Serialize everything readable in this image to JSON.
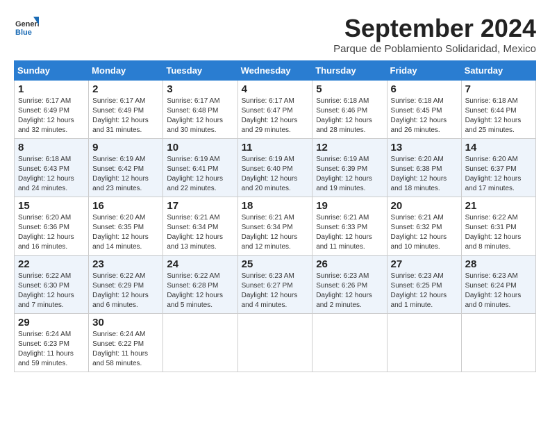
{
  "logo": {
    "general": "General",
    "blue": "Blue"
  },
  "title": "September 2024",
  "subtitle": "Parque de Poblamiento Solidaridad, Mexico",
  "days_of_week": [
    "Sunday",
    "Monday",
    "Tuesday",
    "Wednesday",
    "Thursday",
    "Friday",
    "Saturday"
  ],
  "weeks": [
    [
      {
        "day": "1",
        "sunrise": "6:17 AM",
        "sunset": "6:49 PM",
        "daylight": "12 hours and 32 minutes."
      },
      {
        "day": "2",
        "sunrise": "6:17 AM",
        "sunset": "6:49 PM",
        "daylight": "12 hours and 31 minutes."
      },
      {
        "day": "3",
        "sunrise": "6:17 AM",
        "sunset": "6:48 PM",
        "daylight": "12 hours and 30 minutes."
      },
      {
        "day": "4",
        "sunrise": "6:17 AM",
        "sunset": "6:47 PM",
        "daylight": "12 hours and 29 minutes."
      },
      {
        "day": "5",
        "sunrise": "6:18 AM",
        "sunset": "6:46 PM",
        "daylight": "12 hours and 28 minutes."
      },
      {
        "day": "6",
        "sunrise": "6:18 AM",
        "sunset": "6:45 PM",
        "daylight": "12 hours and 26 minutes."
      },
      {
        "day": "7",
        "sunrise": "6:18 AM",
        "sunset": "6:44 PM",
        "daylight": "12 hours and 25 minutes."
      }
    ],
    [
      {
        "day": "8",
        "sunrise": "6:18 AM",
        "sunset": "6:43 PM",
        "daylight": "12 hours and 24 minutes."
      },
      {
        "day": "9",
        "sunrise": "6:19 AM",
        "sunset": "6:42 PM",
        "daylight": "12 hours and 23 minutes."
      },
      {
        "day": "10",
        "sunrise": "6:19 AM",
        "sunset": "6:41 PM",
        "daylight": "12 hours and 22 minutes."
      },
      {
        "day": "11",
        "sunrise": "6:19 AM",
        "sunset": "6:40 PM",
        "daylight": "12 hours and 20 minutes."
      },
      {
        "day": "12",
        "sunrise": "6:19 AM",
        "sunset": "6:39 PM",
        "daylight": "12 hours and 19 minutes."
      },
      {
        "day": "13",
        "sunrise": "6:20 AM",
        "sunset": "6:38 PM",
        "daylight": "12 hours and 18 minutes."
      },
      {
        "day": "14",
        "sunrise": "6:20 AM",
        "sunset": "6:37 PM",
        "daylight": "12 hours and 17 minutes."
      }
    ],
    [
      {
        "day": "15",
        "sunrise": "6:20 AM",
        "sunset": "6:36 PM",
        "daylight": "12 hours and 16 minutes."
      },
      {
        "day": "16",
        "sunrise": "6:20 AM",
        "sunset": "6:35 PM",
        "daylight": "12 hours and 14 minutes."
      },
      {
        "day": "17",
        "sunrise": "6:21 AM",
        "sunset": "6:34 PM",
        "daylight": "12 hours and 13 minutes."
      },
      {
        "day": "18",
        "sunrise": "6:21 AM",
        "sunset": "6:34 PM",
        "daylight": "12 hours and 12 minutes."
      },
      {
        "day": "19",
        "sunrise": "6:21 AM",
        "sunset": "6:33 PM",
        "daylight": "12 hours and 11 minutes."
      },
      {
        "day": "20",
        "sunrise": "6:21 AM",
        "sunset": "6:32 PM",
        "daylight": "12 hours and 10 minutes."
      },
      {
        "day": "21",
        "sunrise": "6:22 AM",
        "sunset": "6:31 PM",
        "daylight": "12 hours and 8 minutes."
      }
    ],
    [
      {
        "day": "22",
        "sunrise": "6:22 AM",
        "sunset": "6:30 PM",
        "daylight": "12 hours and 7 minutes."
      },
      {
        "day": "23",
        "sunrise": "6:22 AM",
        "sunset": "6:29 PM",
        "daylight": "12 hours and 6 minutes."
      },
      {
        "day": "24",
        "sunrise": "6:22 AM",
        "sunset": "6:28 PM",
        "daylight": "12 hours and 5 minutes."
      },
      {
        "day": "25",
        "sunrise": "6:23 AM",
        "sunset": "6:27 PM",
        "daylight": "12 hours and 4 minutes."
      },
      {
        "day": "26",
        "sunrise": "6:23 AM",
        "sunset": "6:26 PM",
        "daylight": "12 hours and 2 minutes."
      },
      {
        "day": "27",
        "sunrise": "6:23 AM",
        "sunset": "6:25 PM",
        "daylight": "12 hours and 1 minute."
      },
      {
        "day": "28",
        "sunrise": "6:23 AM",
        "sunset": "6:24 PM",
        "daylight": "12 hours and 0 minutes."
      }
    ],
    [
      {
        "day": "29",
        "sunrise": "6:24 AM",
        "sunset": "6:23 PM",
        "daylight": "11 hours and 59 minutes."
      },
      {
        "day": "30",
        "sunrise": "6:24 AM",
        "sunset": "6:22 PM",
        "daylight": "11 hours and 58 minutes."
      },
      null,
      null,
      null,
      null,
      null
    ]
  ]
}
